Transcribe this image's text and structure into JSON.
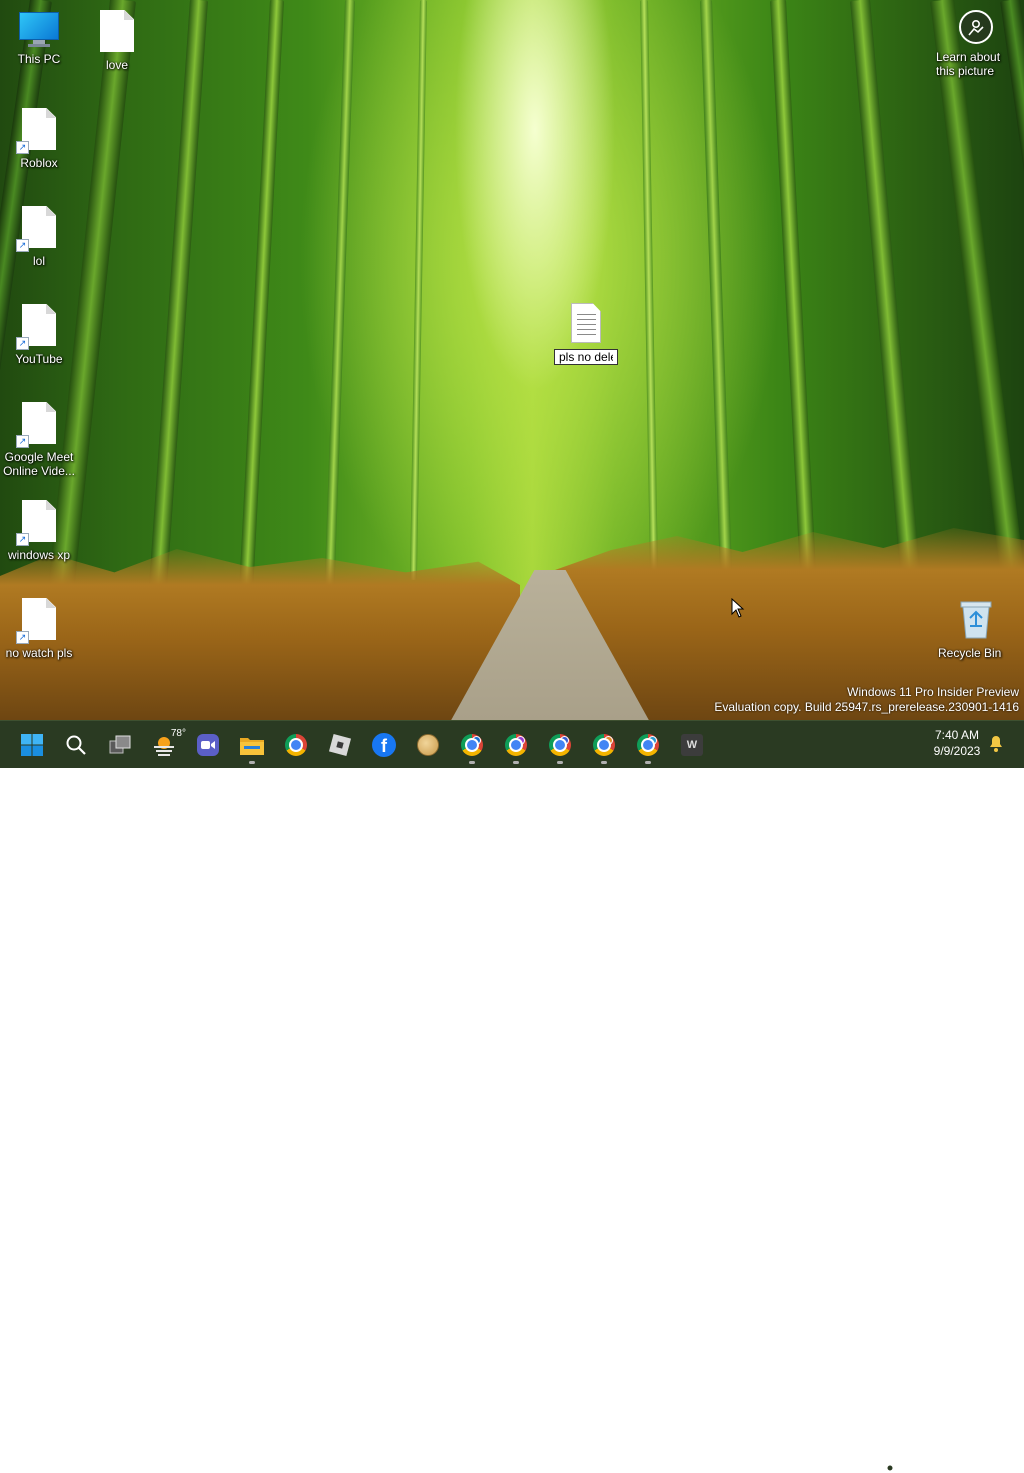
{
  "desktop": {
    "icons": [
      {
        "label": "This PC",
        "glyph": "computer-icon"
      },
      {
        "label": "love",
        "glyph": "file-shortcut-icon"
      },
      {
        "label": "Roblox",
        "glyph": "file-shortcut-icon"
      },
      {
        "label": "lol",
        "glyph": "file-shortcut-icon"
      },
      {
        "label": "YouTube",
        "glyph": "file-shortcut-icon"
      },
      {
        "label": "Google Meet Online Vide...",
        "glyph": "file-shortcut-icon"
      },
      {
        "label": "windows xp",
        "glyph": "file-shortcut-icon"
      },
      {
        "label": "no watch pls",
        "glyph": "file-shortcut-icon"
      }
    ],
    "rename": {
      "value": "pls no delet",
      "glyph": "text-document-icon"
    },
    "learn": {
      "label": "Learn about this picture",
      "glyph": "spotlight-camera-icon"
    },
    "recycle_bin": {
      "label": "Recycle Bin",
      "glyph": "recycle-bin-icon"
    },
    "watermark": {
      "line1": "Windows 11 Pro Insider Preview",
      "line2": "Evaluation copy. Build 25947.rs_prerelease.230901-1416"
    }
  },
  "taskbar": {
    "weather_temp": "78°",
    "word_letter": "W",
    "apps": [
      "start-button",
      "search-button",
      "task-view-button",
      "weather-widget",
      "zoom-app",
      "file-explorer",
      "chrome",
      "roblox",
      "facebook",
      "doge",
      "chrome-profile-1",
      "chrome-profile-2",
      "chrome-profile-3",
      "chrome-profile-4",
      "chrome-profile-5",
      "word-app"
    ],
    "tray": {
      "time": "7:40 AM",
      "date": "9/9/2023"
    }
  },
  "colors": {
    "taskbar": "#2a3a22",
    "windows_blue": "#0a78d4",
    "facebook_blue": "#1877f2",
    "zoom_purple": "#5b5fc7",
    "folder_yellow": "#f8c33a"
  }
}
